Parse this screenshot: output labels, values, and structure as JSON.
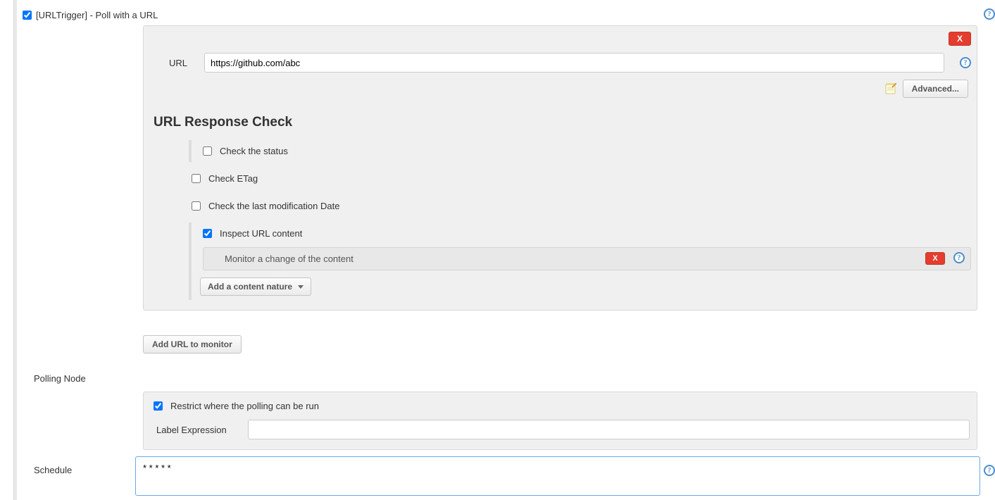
{
  "trigger": {
    "enabled": true,
    "label": "[URLTrigger] - Poll with a URL"
  },
  "url": {
    "label": "URL",
    "value": "https://github.com/abc",
    "advanced_btn": "Advanced...",
    "delete": "X"
  },
  "response": {
    "title": "URL Response Check",
    "check_status": {
      "checked": false,
      "label": "Check the status"
    },
    "check_etag": {
      "checked": false,
      "label": "Check ETag"
    },
    "check_lastmod": {
      "checked": false,
      "label": "Check the last modification Date"
    },
    "inspect": {
      "checked": true,
      "label": "Inspect URL content",
      "monitor_text": "Monitor a change of the content",
      "delete": "X",
      "add_nature": "Add a content nature"
    }
  },
  "add_url_btn": "Add URL to monitor",
  "polling_node": {
    "label": "Polling Node",
    "restrict": {
      "checked": true,
      "label": "Restrict where the polling can be run"
    },
    "label_expr": {
      "label": "Label Expression",
      "value": ""
    }
  },
  "schedule": {
    "label": "Schedule",
    "value": "* * * * *"
  }
}
